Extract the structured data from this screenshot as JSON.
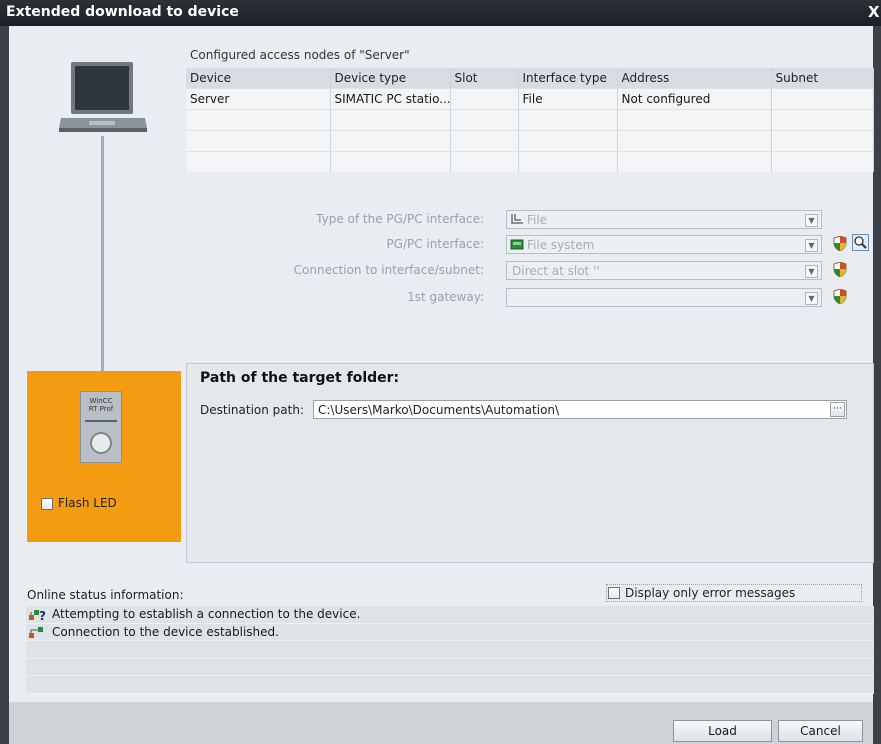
{
  "window": {
    "title": "Extended download to device",
    "close_glyph": "X"
  },
  "nodes": {
    "caption": "Configured access nodes of \"Server\"",
    "columns": [
      "Device",
      "Device type",
      "Slot",
      "Interface type",
      "Address",
      "Subnet"
    ],
    "rows": [
      [
        "Server",
        "SIMATIC PC statio...",
        "",
        "File",
        "Not configured",
        ""
      ],
      [
        "",
        "",
        "",
        "",
        "",
        ""
      ],
      [
        "",
        "",
        "",
        "",
        "",
        ""
      ],
      [
        "",
        "",
        "",
        "",
        "",
        ""
      ]
    ]
  },
  "interface": {
    "type_label": "Type of the PG/PC interface:",
    "type_value": "File",
    "pgpc_label": "PG/PC interface:",
    "pgpc_value": "File system",
    "conn_label": "Connection to interface/subnet:",
    "conn_value": "Direct at slot ''",
    "gateway_label": "1st gateway:",
    "gateway_value": ""
  },
  "target": {
    "heading": "Path of the target folder:",
    "dest_label": "Destination path:",
    "dest_value": "C:\\Users\\Marko\\Documents\\Automation\\",
    "browse_glyph": "···"
  },
  "device_panel": {
    "module_text_1": "WinCC",
    "module_text_2": "RT Prof",
    "flash_label": "Flash LED"
  },
  "status": {
    "label": "Online status information:",
    "error_only_label": "Display only error messages",
    "messages": [
      "Attempting to establish a connection to the device.",
      "Connection to the device established."
    ]
  },
  "buttons": {
    "load": "Load",
    "cancel": "Cancel"
  },
  "colors": {
    "device_panel": "#f39c12",
    "titlebar": "#1c1f24"
  }
}
